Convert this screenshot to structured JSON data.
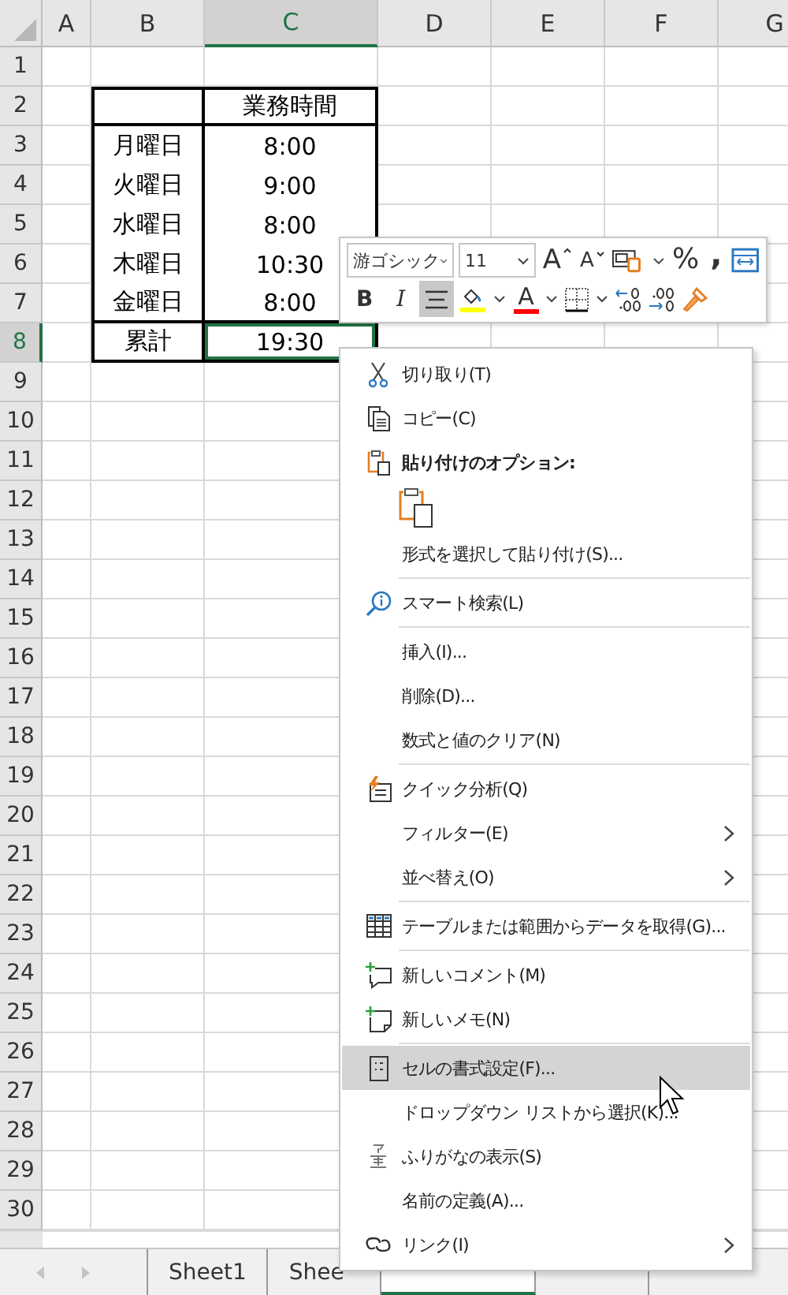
{
  "columns": [
    {
      "label": "A",
      "selected": false
    },
    {
      "label": "B",
      "selected": false
    },
    {
      "label": "C",
      "selected": true
    },
    {
      "label": "D",
      "selected": false
    },
    {
      "label": "E",
      "selected": false
    },
    {
      "label": "F",
      "selected": false
    },
    {
      "label": "G",
      "selected": false
    }
  ],
  "row_numbers": [
    {
      "label": "1",
      "selected": false
    },
    {
      "label": "2",
      "selected": false
    },
    {
      "label": "3",
      "selected": false
    },
    {
      "label": "4",
      "selected": false
    },
    {
      "label": "5",
      "selected": false
    },
    {
      "label": "6",
      "selected": false
    },
    {
      "label": "7",
      "selected": false
    },
    {
      "label": "8",
      "selected": true
    },
    {
      "label": "9",
      "selected": false
    },
    {
      "label": "10",
      "selected": false
    },
    {
      "label": "11",
      "selected": false
    },
    {
      "label": "12",
      "selected": false
    },
    {
      "label": "13",
      "selected": false
    },
    {
      "label": "14",
      "selected": false
    },
    {
      "label": "15",
      "selected": false
    },
    {
      "label": "16",
      "selected": false
    },
    {
      "label": "17",
      "selected": false
    },
    {
      "label": "18",
      "selected": false
    },
    {
      "label": "19",
      "selected": false
    },
    {
      "label": "20",
      "selected": false
    },
    {
      "label": "21",
      "selected": false
    },
    {
      "label": "22",
      "selected": false
    },
    {
      "label": "23",
      "selected": false
    },
    {
      "label": "24",
      "selected": false
    },
    {
      "label": "25",
      "selected": false
    },
    {
      "label": "26",
      "selected": false
    },
    {
      "label": "27",
      "selected": false
    },
    {
      "label": "28",
      "selected": false
    },
    {
      "label": "29",
      "selected": false
    },
    {
      "label": "30",
      "selected": false
    }
  ],
  "table": {
    "header": "業務時間",
    "rows": [
      {
        "day": "月曜日",
        "hours": "8:00"
      },
      {
        "day": "火曜日",
        "hours": "9:00"
      },
      {
        "day": "水曜日",
        "hours": "8:00"
      },
      {
        "day": "木曜日",
        "hours": "10:30"
      },
      {
        "day": "金曜日",
        "hours": "8:00"
      }
    ],
    "total": {
      "label": "累計",
      "value": "19:30",
      "selected": true
    }
  },
  "mini_toolbar": {
    "font_name": "游ゴシック",
    "font_size": "11",
    "grow_font": "A",
    "shrink_font": "A",
    "percent": "%",
    "comma": ",",
    "bold": "B",
    "italic": "I",
    "font_color_letter": "A",
    "align_center_selected": true
  },
  "context_menu": [
    {
      "kind": "item",
      "label": "切り取り(T)",
      "highlighted": false,
      "submenu": false
    },
    {
      "kind": "item",
      "label": "コピー(C)",
      "highlighted": false,
      "submenu": false
    },
    {
      "kind": "header",
      "label": "貼り付けのオプション:"
    },
    {
      "kind": "paste-options"
    },
    {
      "kind": "item",
      "label": "形式を選択して貼り付け(S)...",
      "highlighted": false,
      "submenu": false
    },
    {
      "kind": "separator"
    },
    {
      "kind": "item",
      "label": "スマート検索(L)",
      "highlighted": false,
      "submenu": false
    },
    {
      "kind": "separator"
    },
    {
      "kind": "item",
      "label": "挿入(I)...",
      "highlighted": false,
      "submenu": false
    },
    {
      "kind": "item",
      "label": "削除(D)...",
      "highlighted": false,
      "submenu": false
    },
    {
      "kind": "item",
      "label": "数式と値のクリア(N)",
      "highlighted": false,
      "submenu": false
    },
    {
      "kind": "separator"
    },
    {
      "kind": "item",
      "label": "クイック分析(Q)",
      "highlighted": false,
      "submenu": false
    },
    {
      "kind": "item",
      "label": "フィルター(E)",
      "highlighted": false,
      "submenu": true
    },
    {
      "kind": "item",
      "label": "並べ替え(O)",
      "highlighted": false,
      "submenu": true
    },
    {
      "kind": "separator"
    },
    {
      "kind": "item",
      "label": "テーブルまたは範囲からデータを取得(G)...",
      "highlighted": false,
      "submenu": false
    },
    {
      "kind": "separator"
    },
    {
      "kind": "item",
      "label": "新しいコメント(M)",
      "highlighted": false,
      "submenu": false
    },
    {
      "kind": "item",
      "label": "新しいメモ(N)",
      "highlighted": false,
      "submenu": false
    },
    {
      "kind": "separator"
    },
    {
      "kind": "item",
      "label": "セルの書式設定(F)...",
      "highlighted": true,
      "submenu": false
    },
    {
      "kind": "item",
      "label": "ドロップダウン リストから選択(K)...",
      "highlighted": false,
      "submenu": false
    },
    {
      "kind": "item",
      "label": "ふりがなの表示(S)",
      "highlighted": false,
      "submenu": false
    },
    {
      "kind": "item",
      "label": "名前の定義(A)...",
      "highlighted": false,
      "submenu": false
    },
    {
      "kind": "item",
      "label": "リンク(I)",
      "highlighted": false,
      "submenu": true
    }
  ],
  "sheet_tabs": [
    {
      "label": "Sheet1",
      "selected": false
    },
    {
      "label": "Shee",
      "selected": false
    },
    {
      "selected": true
    },
    {
      "selected": false
    }
  ]
}
